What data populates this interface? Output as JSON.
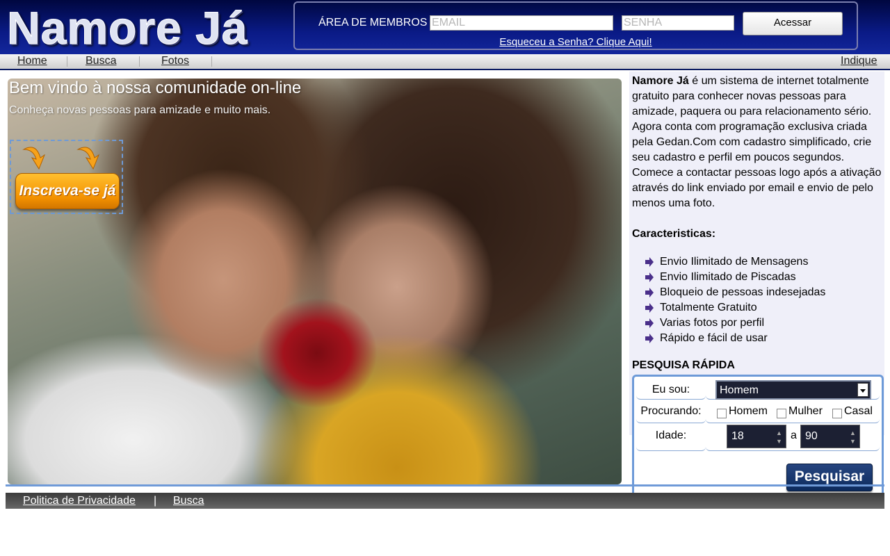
{
  "header": {
    "logo_text": "Namore Já",
    "members_label": "ÁREA DE MEMBROS",
    "email_placeholder": "EMAIL",
    "password_placeholder": "SENHA",
    "login_button": "Acessar",
    "forgot_link": "Esqueceu a Senha? Clique Aqui!"
  },
  "nav": {
    "items": [
      {
        "label": "Home"
      },
      {
        "label": "Busca"
      },
      {
        "label": "Fotos"
      }
    ],
    "right_link": "Indique"
  },
  "hero": {
    "title": "Bem vindo à nossa comunidade on-line",
    "subtitle": "Conheça novas pessoas para amizade e muito mais.",
    "signup_button": "Inscreva-se já"
  },
  "side": {
    "intro_brand": "Namore Já",
    "intro_text": " é um sistema de internet totalmente gratuito para conhecer novas pessoas para amizade, paquera ou para relacionamento sério. Agora conta com programação exclusiva criada pela Gedan.Com com cadastro simplificado, crie seu cadastro e perfil em poucos segundos. Comece a contactar pessoas logo após a ativação através do link enviado por email e envio de pelo menos uma foto.",
    "features_title": "Caracteristicas:",
    "features": [
      "Envio Ilimitado de Mensagens",
      "Envio Ilimitado de Piscadas",
      "Bloqueio de pessoas indesejadas",
      "Totalmente Gratuito",
      "Varias fotos por perfil",
      "Rápido e fácil de usar"
    ],
    "quick_search_title": "PESQUISA RÁPIDA"
  },
  "search": {
    "i_am_label": "Eu sou:",
    "i_am_value": "Homem",
    "looking_label": "Procurando:",
    "options": [
      "Homem",
      "Mulher",
      "Casal"
    ],
    "age_label": "Idade:",
    "age_min": "18",
    "age_separator": "a",
    "age_max": "90",
    "button": "Pesquisar"
  },
  "footer": {
    "privacy_link": "Politica de Privacidade",
    "separator": "|",
    "search_link": "Busca"
  },
  "colors": {
    "header_bg": "#0a1a86",
    "accent_blue": "#6d9ad8",
    "button_navy": "#0c2a5d",
    "signup_orange": "#f39100"
  }
}
